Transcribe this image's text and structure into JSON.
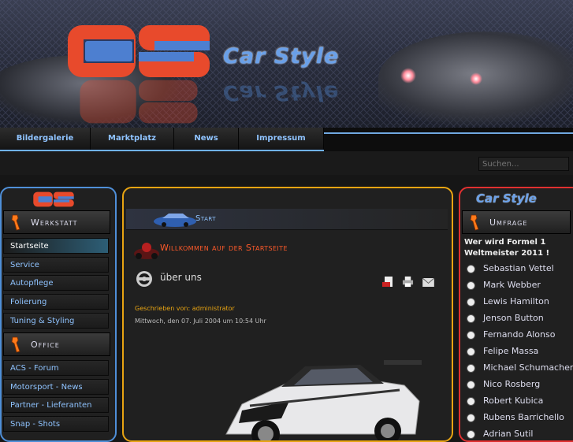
{
  "header": {
    "logo_text": "Car Style",
    "logo_text_reflection": "Car Style",
    "logo_letters": "CS"
  },
  "nav": {
    "items": [
      "Bildergalerie",
      "Marktplatz",
      "News",
      "Impressum"
    ]
  },
  "search": {
    "placeholder": "Suchen..."
  },
  "left": {
    "section1_title": "Werkstatt",
    "section1_items": [
      "Startseite",
      "Service",
      "Autopflege",
      "Folierung",
      "Tuning & Styling"
    ],
    "section2_title": "Office",
    "section2_items": [
      "ACS - Forum",
      "Motorsport - News",
      "Partner - Lieferanten",
      "Snap - Shots"
    ]
  },
  "center": {
    "breadcrumb": "Start",
    "welcome": "Willkommen auf der Startseite",
    "about": "über uns",
    "author": "Geschrieben von: administrator",
    "date": "Mittwoch, den 07. Juli 2004 um 10:54 Uhr"
  },
  "right": {
    "logo_text": "Car Style",
    "section_title": "Umfrage",
    "question": "Wer wird Formel 1 Weltmeister 2011 !",
    "options": [
      "Sebastian Vettel",
      "Mark Webber",
      "Lewis Hamilton",
      "Jenson Button",
      "Fernando Alonso",
      "Felipe Massa",
      "Michael Schumacher",
      "Nico Rosberg",
      "Robert Kubica",
      "Rubens Barrichello",
      "Adrian Sutil"
    ]
  },
  "colors": {
    "accent_blue": "#6fb2ff",
    "logo_red": "#e84a2c",
    "panel_orange": "#e8a412",
    "panel_red": "#e03030"
  }
}
